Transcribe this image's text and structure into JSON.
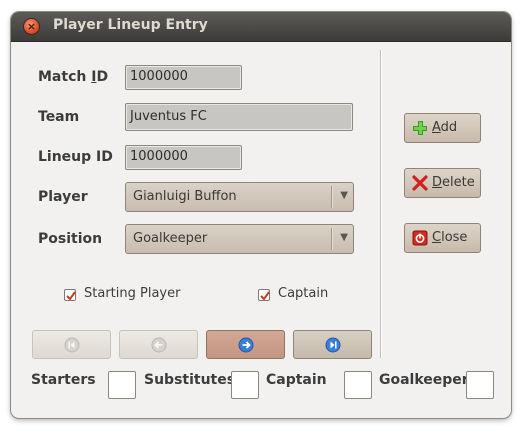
{
  "window": {
    "title": "Player Lineup Entry"
  },
  "form": {
    "match_id": {
      "label_pre": "Match ",
      "label_mnemonic": "I",
      "label_post": "D",
      "value": "1000000"
    },
    "team": {
      "label": "Team",
      "value": "Juventus FC"
    },
    "lineup_id": {
      "label": "Lineup ID",
      "value": "1000000"
    },
    "player": {
      "label": "Player",
      "selected": "Gianluigi Buffon"
    },
    "position": {
      "label": "Position",
      "selected": "Goalkeeper"
    }
  },
  "checkboxes": {
    "starting_player": {
      "label": "Starting Player",
      "checked": true
    },
    "captain": {
      "label": "Captain",
      "checked": true
    }
  },
  "actions": {
    "add": {
      "mnemonic": "A",
      "rest": "dd",
      "icon": "plus-icon"
    },
    "delete": {
      "mnemonic": "D",
      "rest": "elete",
      "icon": "delete-x-icon"
    },
    "close": {
      "mnemonic": "C",
      "rest": "lose",
      "icon": "close-door-icon"
    }
  },
  "navigation": [
    {
      "name": "first-record",
      "icon": "first-icon",
      "enabled": false
    },
    {
      "name": "previous-record",
      "icon": "previous-icon",
      "enabled": false
    },
    {
      "name": "next-record",
      "icon": "next-icon",
      "enabled": true
    },
    {
      "name": "last-record",
      "icon": "last-icon",
      "enabled": true
    }
  ],
  "summary": {
    "starters": {
      "label": "Starters",
      "value": ""
    },
    "substitutes": {
      "label": "Substitutes",
      "value": ""
    },
    "captain": {
      "label": "Captain",
      "value": ""
    },
    "goalkeeper": {
      "label": "Goalkeeper",
      "value": ""
    }
  },
  "colors": {
    "titlebar": "#3c3b37",
    "window_bg": "#f2f1f0",
    "active_nav": "#c8998a",
    "checkbox_mark": "#c23a28"
  }
}
